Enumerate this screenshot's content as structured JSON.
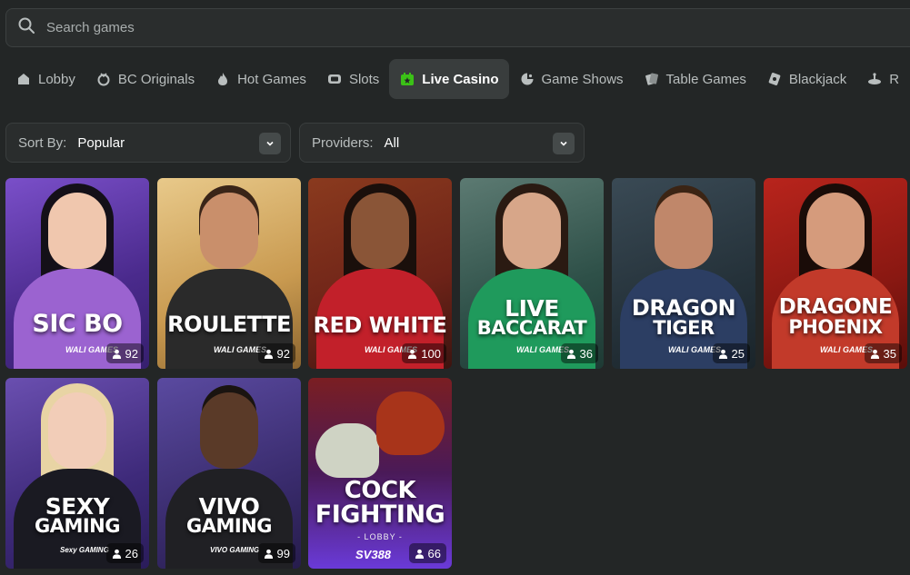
{
  "search": {
    "placeholder": "Search games"
  },
  "tabs": [
    {
      "label": "Lobby",
      "icon": "home-icon"
    },
    {
      "label": "BC Originals",
      "icon": "bc-originals-icon"
    },
    {
      "label": "Hot Games",
      "icon": "flame-icon"
    },
    {
      "label": "Slots",
      "icon": "slots-icon"
    },
    {
      "label": "Live Casino",
      "icon": "live-casino-icon",
      "active": true
    },
    {
      "label": "Game Shows",
      "icon": "game-shows-icon"
    },
    {
      "label": "Table Games",
      "icon": "cards-icon"
    },
    {
      "label": "Blackjack",
      "icon": "blackjack-icon"
    },
    {
      "label": "R",
      "icon": "roulette-icon"
    }
  ],
  "filters": {
    "sort_label": "Sort By:",
    "sort_value": "Popular",
    "providers_label": "Providers:",
    "providers_value": "All"
  },
  "games": [
    {
      "title": "SIC BO",
      "provider": "WALI GAMES",
      "players": "92"
    },
    {
      "title": "ROULETTE",
      "provider": "WALI GAMES",
      "players": "92"
    },
    {
      "title": "RED WHITE",
      "provider": "WALI GAMES",
      "players": "100"
    },
    {
      "title_line1": "LIVE",
      "title_line2": "BACCARAT",
      "provider": "WALI GAMES",
      "players": "36"
    },
    {
      "title_line1": "DRAGON",
      "title_line2": "TIGER",
      "provider": "WALI GAMES",
      "players": "25"
    },
    {
      "title_line1": "DRAGONE",
      "title_line2": "PHOENIX",
      "provider": "WALI GAMES",
      "players": "35"
    },
    {
      "title_line1": "SEXY",
      "title_line2": "GAMING",
      "provider": "Sexy GAMING",
      "players": "26"
    },
    {
      "title_line1": "VIVO",
      "title_line2": "GAMING",
      "provider": "VIVO GAMING",
      "players": "99"
    },
    {
      "title_line1": "COCK",
      "title_line2": "FIGHTING",
      "subtitle": "- LOBBY -",
      "provider": "SV388",
      "players": "66"
    }
  ],
  "colors": {
    "background": "#232626",
    "active_tab": "#393d3d",
    "live_casino_icon": "#3bc117"
  }
}
